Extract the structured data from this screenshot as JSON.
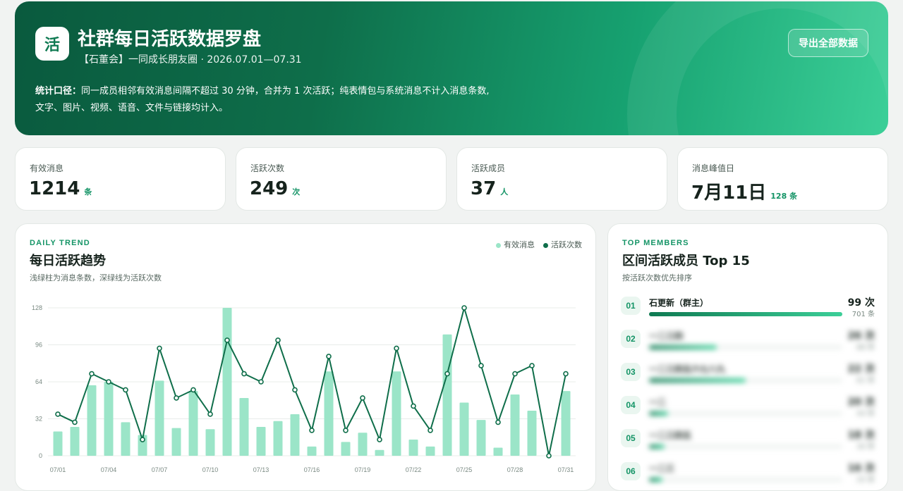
{
  "hero": {
    "logo_char": "活",
    "title": "社群每日活跃数据罗盘",
    "subtitle": "【石董会】一同成长朋友圈 · 2026.07.01—07.31",
    "note_label": "统计口径：",
    "note_line1": "同一成员相邻有效消息间隔不超过 30 分钟，合并为 1 次活跃；纯表情包与系统消息不计入消息条数,",
    "note_line2": "文字、图片、视频、语音、文件与链接均计入。",
    "export_label": "导出全部数据"
  },
  "stats": [
    {
      "label": "有效消息",
      "value": "1214",
      "unit": "条"
    },
    {
      "label": "活跃次数",
      "value": "249",
      "unit": "次"
    },
    {
      "label": "活跃成员",
      "value": "37",
      "unit": "人"
    },
    {
      "label": "消息峰值日",
      "value": "7月11日",
      "unit": "128 条"
    }
  ],
  "trend": {
    "eyebrow": "DAILY TREND",
    "title": "每日活跃趋势",
    "subtitle": "浅绿柱为消息条数，深绿线为活跃次数",
    "legend_bar": "有效消息",
    "legend_line": "活跃次数",
    "colors": {
      "bar": "#9be5c8",
      "line": "#0f6e4a"
    }
  },
  "chart_data": {
    "type": "bar",
    "title": "每日活跃趋势",
    "xlabel": "",
    "ylabel": "",
    "ylim": [
      0,
      128
    ],
    "yticks": [
      0,
      32,
      64,
      96,
      128
    ],
    "categories": [
      "07/01",
      "07/02",
      "07/03",
      "07/04",
      "07/05",
      "07/06",
      "07/07",
      "07/08",
      "07/09",
      "07/10",
      "07/11",
      "07/12",
      "07/13",
      "07/14",
      "07/15",
      "07/16",
      "07/17",
      "07/18",
      "07/19",
      "07/20",
      "07/21",
      "07/22",
      "07/23",
      "07/24",
      "07/25",
      "07/26",
      "07/27",
      "07/28",
      "07/29",
      "07/30",
      "07/31"
    ],
    "xtick_labels": [
      "07/01",
      "07/04",
      "07/07",
      "07/10",
      "07/13",
      "07/16",
      "07/19",
      "07/22",
      "07/25",
      "07/28",
      "07/31"
    ],
    "series": [
      {
        "name": "有效消息",
        "type": "bar",
        "values": [
          21,
          25,
          61,
          64,
          29,
          18,
          65,
          24,
          56,
          23,
          128,
          50,
          25,
          30,
          36,
          8,
          73,
          12,
          20,
          5,
          73,
          14,
          8,
          105,
          46,
          31,
          7,
          53,
          39,
          0,
          56
        ]
      },
      {
        "name": "活跃次数",
        "type": "line",
        "values": [
          36,
          29,
          71,
          64,
          57,
          14,
          93,
          50,
          57,
          36,
          100,
          71,
          64,
          100,
          57,
          22,
          86,
          22,
          50,
          14,
          93,
          43,
          22,
          71,
          128,
          78,
          29,
          71,
          78,
          0,
          71
        ]
      }
    ]
  },
  "members": {
    "eyebrow": "TOP MEMBERS",
    "title": "区间活跃成员 Top 15",
    "subtitle": "按活跃次数优先排序",
    "items": [
      {
        "rank": "01",
        "name": "石更新（群主）",
        "count": "99 次",
        "msgs": "701 条",
        "fraction": 1.0
      },
      {
        "rank": "02",
        "name": "一二三四",
        "count": "26 次",
        "msgs": "88 条",
        "fraction": 0.35
      },
      {
        "rank": "03",
        "name": "一二三四五六七八九",
        "count": "22 次",
        "msgs": "61 条",
        "fraction": 0.5
      },
      {
        "rank": "04",
        "name": "一二",
        "count": "20 次",
        "msgs": "44 条",
        "fraction": 0.1
      },
      {
        "rank": "05",
        "name": "一二三四五",
        "count": "18 次",
        "msgs": "30 条",
        "fraction": 0.08
      },
      {
        "rank": "06",
        "name": "一二三",
        "count": "16 次",
        "msgs": "25 条",
        "fraction": 0.07
      }
    ]
  }
}
